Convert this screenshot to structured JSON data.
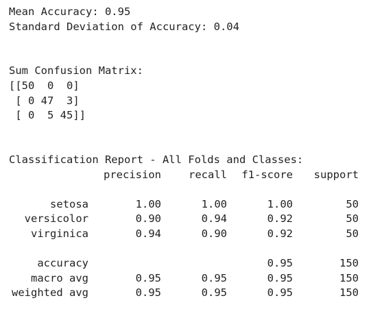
{
  "summary": {
    "mean_accuracy": "Mean Accuracy: 0.95",
    "std_accuracy": "Standard Deviation of Accuracy: 0.04"
  },
  "confusion": {
    "title": "Sum Confusion Matrix:",
    "rows": [
      "[[50  0  0]",
      " [ 0 47  3]",
      " [ 0  5 45]]"
    ]
  },
  "report": {
    "title": "Classification Report - All Folds and Classes:",
    "headers": {
      "precision": "precision",
      "recall": "recall",
      "f1": "f1-score",
      "support": "support"
    },
    "classes": [
      {
        "label": "setosa",
        "precision": "1.00",
        "recall": "1.00",
        "f1": "1.00",
        "support": "50"
      },
      {
        "label": "versicolor",
        "precision": "0.90",
        "recall": "0.94",
        "f1": "0.92",
        "support": "50"
      },
      {
        "label": "virginica",
        "precision": "0.94",
        "recall": "0.90",
        "f1": "0.92",
        "support": "50"
      }
    ],
    "accuracy": {
      "label": "accuracy",
      "f1": "0.95",
      "support": "150"
    },
    "macro": {
      "label": "macro avg",
      "precision": "0.95",
      "recall": "0.95",
      "f1": "0.95",
      "support": "150"
    },
    "weighted": {
      "label": "weighted avg",
      "precision": "0.95",
      "recall": "0.95",
      "f1": "0.95",
      "support": "150"
    }
  }
}
